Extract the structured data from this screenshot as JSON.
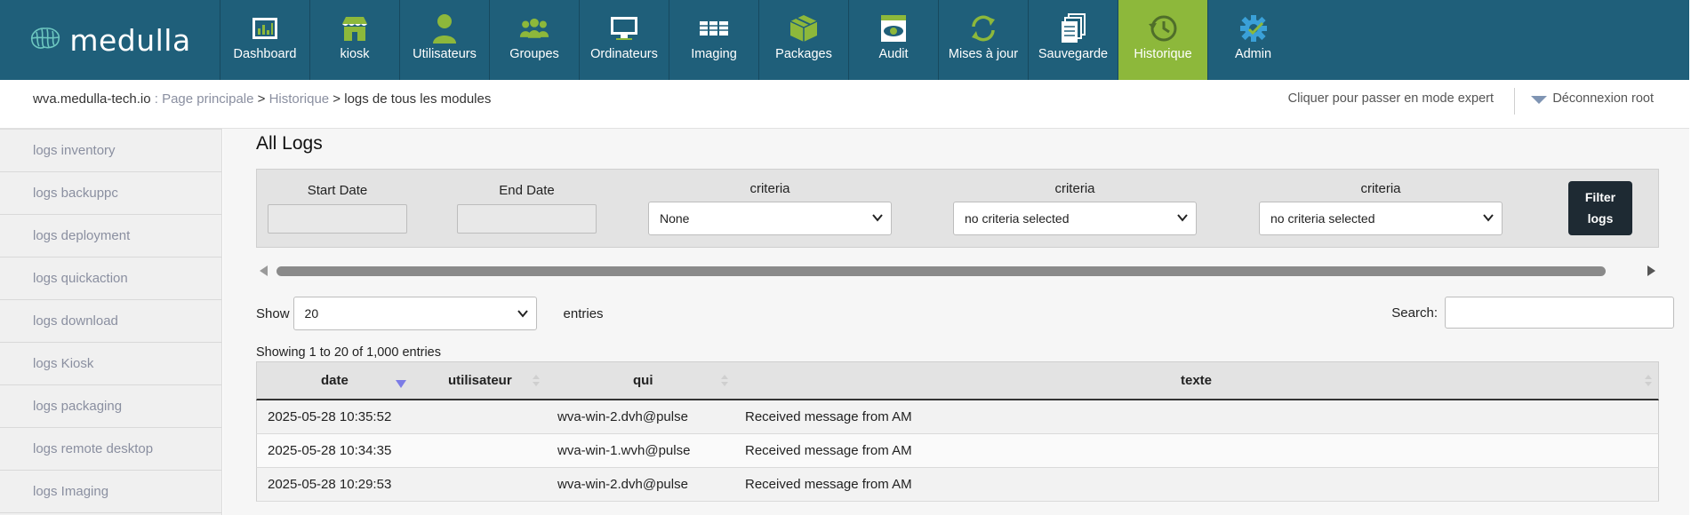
{
  "app": {
    "logo_text": "medulla"
  },
  "nav": {
    "items": [
      {
        "label": "Dashboard",
        "icon": "dashboard-icon"
      },
      {
        "label": "kiosk",
        "icon": "kiosk-icon"
      },
      {
        "label": "Utilisateurs",
        "icon": "user-icon"
      },
      {
        "label": "Groupes",
        "icon": "group-icon"
      },
      {
        "label": "Ordinateurs",
        "icon": "computer-icon"
      },
      {
        "label": "Imaging",
        "icon": "imaging-icon"
      },
      {
        "label": "Packages",
        "icon": "packages-icon"
      },
      {
        "label": "Audit",
        "icon": "audit-icon"
      },
      {
        "label": "Mises à jour",
        "icon": "update-icon"
      },
      {
        "label": "Sauvegarde",
        "icon": "backup-icon"
      },
      {
        "label": "Historique",
        "icon": "history-icon",
        "active": true
      },
      {
        "label": "Admin",
        "icon": "admin-gear-icon"
      }
    ],
    "active_color": "#8db83b",
    "bar_color": "#1f5f7a"
  },
  "breadcrumb": {
    "host": "wva.medulla-tech.io",
    "sep1": " : ",
    "home": "Page principale",
    "sep2": " > ",
    "section": "Historique",
    "sep3": " > ",
    "current": "logs de tous les modules"
  },
  "header_right": {
    "expert_mode": "Cliquer pour passer en mode expert",
    "logout": "Déconnexion root"
  },
  "sidebar": {
    "items": [
      {
        "label": "logs inventory"
      },
      {
        "label": "logs backuppc"
      },
      {
        "label": "logs deployment"
      },
      {
        "label": "logs quickaction"
      },
      {
        "label": "logs download"
      },
      {
        "label": "logs Kiosk"
      },
      {
        "label": "logs packaging"
      },
      {
        "label": "logs remote desktop"
      },
      {
        "label": "logs Imaging"
      }
    ]
  },
  "main": {
    "title": "All Logs",
    "filters": {
      "start_date_label": "Start Date",
      "end_date_label": "End Date",
      "criteria1_label": "criteria",
      "criteria1_value": "None",
      "criteria2_label": "criteria",
      "criteria2_value": "no criteria selected",
      "criteria3_label": "criteria",
      "criteria3_value": "no criteria selected",
      "filter_button_line1": "Filter",
      "filter_button_line2": "logs"
    },
    "length": {
      "show_label": "Show",
      "value": "20",
      "entries_label": "entries"
    },
    "search": {
      "label": "Search:"
    },
    "info": "Showing 1 to 20 of 1,000 entries",
    "table": {
      "columns": [
        "date",
        "utilisateur",
        "qui",
        "texte"
      ],
      "rows": [
        {
          "date": "2025-05-28 10:35:52",
          "utilisateur": "",
          "qui": "wva-win-2.dvh@pulse",
          "texte": "Received message from AM"
        },
        {
          "date": "2025-05-28 10:34:35",
          "utilisateur": "",
          "qui": "wva-win-1.wvh@pulse",
          "texte": "Received message from AM"
        },
        {
          "date": "2025-05-28 10:29:53",
          "utilisateur": "",
          "qui": "wva-win-2.dvh@pulse",
          "texte": "Received message from AM"
        }
      ]
    }
  }
}
